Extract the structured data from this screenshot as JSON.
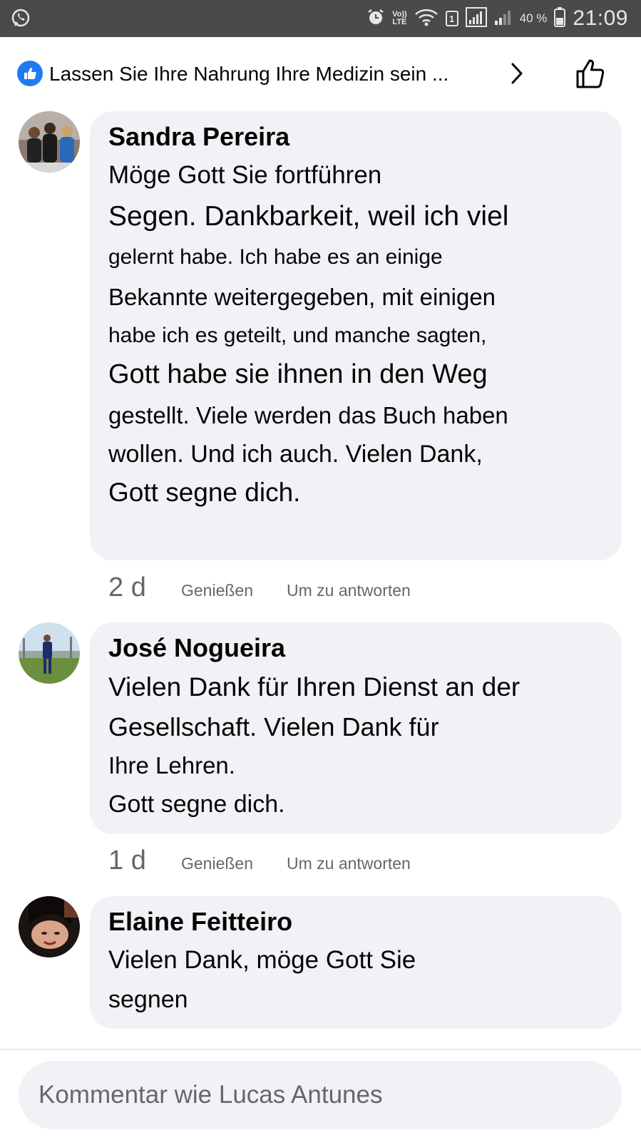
{
  "status_bar": {
    "left_icon": "whatsapp-icon",
    "icons": [
      "alarm-icon",
      "volte-icon",
      "wifi-icon",
      "sim-icon",
      "signal-icon",
      "signal-weak-icon",
      "battery-icon"
    ],
    "volte_line1": "Vo))",
    "volte_line2": "LTE",
    "sim_number": "1",
    "battery_percent": "40 %",
    "time": "21:09"
  },
  "header": {
    "badge_icon": "like-badge-icon",
    "title": "Lassen Sie Ihre Nahrung Ihre Medizin sein ...",
    "chevron_icon": "chevron-right-icon",
    "like_icon": "thumbs-up-icon"
  },
  "comments": [
    {
      "author": "Sandra Pereira",
      "lines": [
        "Möge Gott Sie fortführen",
        "Segen. Dankbarkeit, weil ich viel",
        "gelernt habe. Ich habe es an einige",
        "Bekannte weitergegeben, mit einigen",
        "habe ich es geteilt, und manche sagten,",
        "Gott habe sie ihnen in den Weg",
        "gestellt. Viele werden das Buch haben",
        "wollen. Und ich auch. Vielen Dank,",
        "Gott segne dich."
      ],
      "time": "2 d",
      "like_label": "Genießen",
      "reply_label": "Um zu antworten"
    },
    {
      "author": "José Nogueira",
      "lines": [
        "Vielen Dank für Ihren Dienst an der",
        "Gesellschaft. Vielen Dank für",
        "Ihre Lehren.",
        "Gott segne dich."
      ],
      "time": "1 d",
      "like_label": "Genießen",
      "reply_label": "Um zu antworten"
    },
    {
      "author": "Elaine Feitteiro",
      "lines": [
        "Vielen Dank, möge Gott Sie",
        "segnen"
      ]
    }
  ],
  "composer": {
    "placeholder": "Kommentar wie Lucas Antunes"
  },
  "colors": {
    "status_bar_bg": "#4a4a4a",
    "bubble_bg": "#f0f2f5",
    "brand_blue": "#1f7bf2",
    "secondary_text": "#65676b"
  }
}
